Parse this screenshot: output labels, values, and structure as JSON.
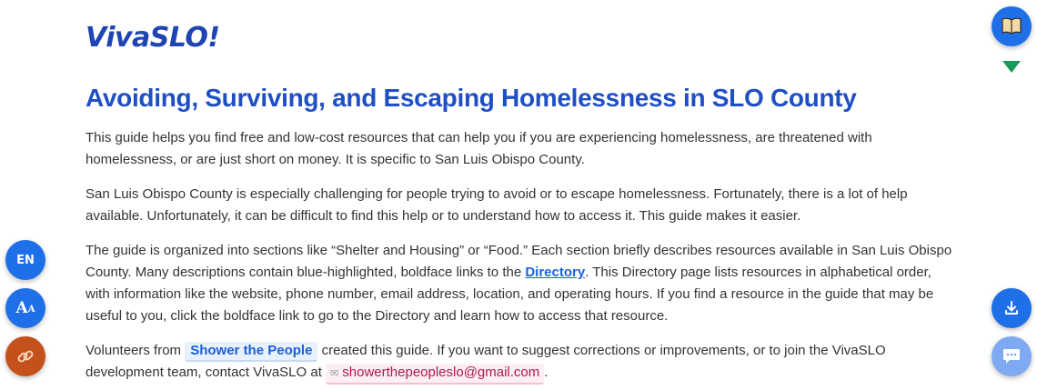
{
  "header": {
    "logo": "VivaSLO!"
  },
  "main": {
    "title": "Avoiding, Surviving, and Escaping Homelessness in SLO County",
    "p1": "This guide helps you find free and low-cost resources that can help you if you are experiencing homelessness, are threatened with homelessness, or are just short on money. It is specific to San Luis Obispo County.",
    "p2": "San Luis Obispo County is especially challenging for people trying to avoid or to escape homelessness. Fortunately, there is a lot of help available. Unfortunately, it can be difficult to find this help or to understand how to access it. This guide makes it easier.",
    "p3_before": "The guide is organized into sections like “Shelter and Housing” or “Food.” Each section briefly describes resources available in San Luis Obispo County. Many descriptions contain blue-highlighted, boldface links to the ",
    "p3_link": "Directory",
    "p3_after": ". This Directory page lists resources in alphabetical order, with information like the website, phone number, email address, location, and operating hours. If you find a resource in the guide that may be useful to you, click the boldface link to go to the Directory and learn how to access that resource.",
    "p4_before": "Volunteers from ",
    "p4_link": "Shower the People",
    "p4_middle": " created this guide. If you want to suggest corrections or improvements, or to join the VivaSLO development team, contact VivaSLO at ",
    "p4_email": "showerthepeopleslo@gmail.com",
    "p4_after": "."
  },
  "controls": {
    "language_label": "EN",
    "font_size_label_big": "A",
    "font_size_label_small": "A"
  },
  "icons": {
    "top_right": "book-icon",
    "indicator": "triangle-down-icon",
    "download": "download-icon",
    "chat": "chat-icon",
    "link": "link-icon",
    "email": "mail-icon"
  },
  "colors": {
    "accent": "#1e6fe8",
    "title": "#1f4fc4",
    "link_button": "#c4501b",
    "indicator": "#1a9a56",
    "email": "#b0184f"
  }
}
